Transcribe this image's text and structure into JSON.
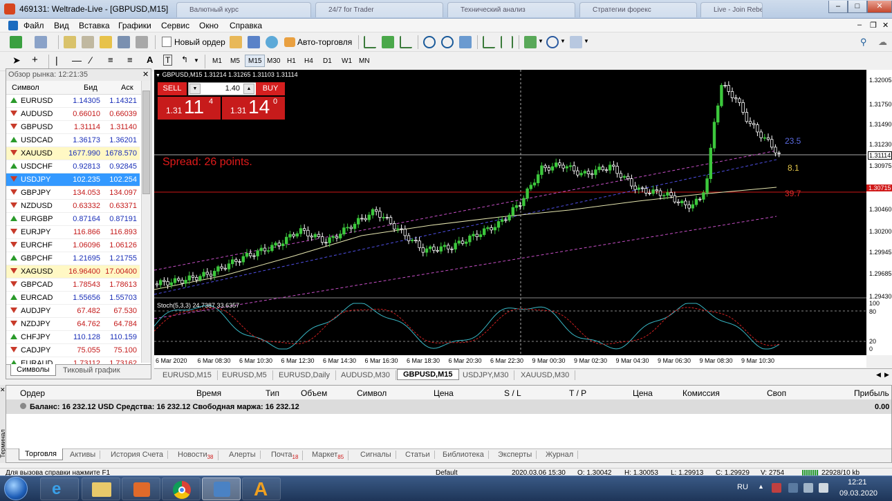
{
  "window": {
    "title": "469131: Weltrade-Live - [GBPUSD,M15]"
  },
  "browser_tabs": [
    "Валютный курс",
    "24/7 for Trader",
    "Технический анализ",
    "Стратегии форекс",
    "Live - Join Rebel",
    ""
  ],
  "menu": [
    "Файл",
    "Вид",
    "Вставка",
    "Графики",
    "Сервис",
    "Окно",
    "Справка"
  ],
  "toolbar": {
    "new_order": "Новый ордер",
    "autotrading": "Авто-торговля"
  },
  "timeframes": [
    "M1",
    "M5",
    "M15",
    "M30",
    "H1",
    "H4",
    "D1",
    "W1",
    "MN"
  ],
  "market_watch": {
    "header": "Обзор рынка: 12:21:35",
    "col_symbol": "Символ",
    "col_bid": "Бид",
    "col_ask": "Аск",
    "rows": [
      {
        "symbol": "EURUSD",
        "bid": "1.14305",
        "ask": "1.14321",
        "dir": "up",
        "color": "blue"
      },
      {
        "symbol": "AUDUSD",
        "bid": "0.66010",
        "ask": "0.66039",
        "dir": "down",
        "color": "red"
      },
      {
        "symbol": "GBPUSD",
        "bid": "1.31114",
        "ask": "1.31140",
        "dir": "down",
        "color": "red"
      },
      {
        "symbol": "USDCAD",
        "bid": "1.36173",
        "ask": "1.36201",
        "dir": "up",
        "color": "blue"
      },
      {
        "symbol": "XAUUSD",
        "bid": "1677.990",
        "ask": "1678.570",
        "dir": "down",
        "color": "blue",
        "hl": true
      },
      {
        "symbol": "USDCHF",
        "bid": "0.92813",
        "ask": "0.92845",
        "dir": "up",
        "color": "blue"
      },
      {
        "symbol": "USDJPY",
        "bid": "102.235",
        "ask": "102.254",
        "dir": "down",
        "color": "blue",
        "sel": true
      },
      {
        "symbol": "GBPJPY",
        "bid": "134.053",
        "ask": "134.097",
        "dir": "down",
        "color": "red"
      },
      {
        "symbol": "NZDUSD",
        "bid": "0.63332",
        "ask": "0.63371",
        "dir": "down",
        "color": "red"
      },
      {
        "symbol": "EURGBP",
        "bid": "0.87164",
        "ask": "0.87191",
        "dir": "up",
        "color": "blue"
      },
      {
        "symbol": "EURJPY",
        "bid": "116.866",
        "ask": "116.893",
        "dir": "down",
        "color": "red"
      },
      {
        "symbol": "EURCHF",
        "bid": "1.06096",
        "ask": "1.06126",
        "dir": "down",
        "color": "red"
      },
      {
        "symbol": "GBPCHF",
        "bid": "1.21695",
        "ask": "1.21755",
        "dir": "up",
        "color": "blue"
      },
      {
        "symbol": "XAGUSD",
        "bid": "16.96400",
        "ask": "17.00400",
        "dir": "down",
        "color": "red",
        "hl": true
      },
      {
        "symbol": "GBPCAD",
        "bid": "1.78543",
        "ask": "1.78613",
        "dir": "down",
        "color": "red"
      },
      {
        "symbol": "EURCAD",
        "bid": "1.55656",
        "ask": "1.55703",
        "dir": "up",
        "color": "blue"
      },
      {
        "symbol": "AUDJPY",
        "bid": "67.482",
        "ask": "67.530",
        "dir": "down",
        "color": "red"
      },
      {
        "symbol": "NZDJPY",
        "bid": "64.762",
        "ask": "64.784",
        "dir": "down",
        "color": "red"
      },
      {
        "symbol": "CHFJPY",
        "bid": "110.128",
        "ask": "110.159",
        "dir": "up",
        "color": "blue"
      },
      {
        "symbol": "CADJPY",
        "bid": "75.055",
        "ask": "75.100",
        "dir": "down",
        "color": "red"
      },
      {
        "symbol": "EURAUD",
        "bid": "1.73112",
        "ask": "1.73162",
        "dir": "up",
        "color": "red"
      }
    ],
    "tab_symbols": "Символы",
    "tab_tick": "Тиковый график"
  },
  "chart": {
    "header": "GBPUSD,M15  1.31214 1.31265 1.31103 1.31114",
    "sell_label": "SELL",
    "buy_label": "BUY",
    "lot": "1.40",
    "sell_price_small": "1.31",
    "sell_price_big": "11",
    "sell_price_sup": "4",
    "buy_price_small": "1.31",
    "buy_price_big": "14",
    "buy_price_sup": "0",
    "spread": "Spread: 26 points.",
    "fib_labels": [
      "23.5",
      "8.1",
      "39.7"
    ],
    "stoch_label": "Stoch(5,3,3) 24.7387 33.6357",
    "price_ticks": [
      "1.32005",
      "1.31750",
      "1.31490",
      "1.31230",
      "1.31114",
      "1.30975",
      "1.30715",
      "1.30460",
      "1.30200",
      "1.29945",
      "1.29685",
      "1.29430"
    ],
    "stoch_ticks": [
      "100",
      "80",
      "20",
      "0"
    ],
    "time_ticks": [
      "6 Mar 2020",
      "6 Mar 08:30",
      "6 Mar 10:30",
      "6 Mar 12:30",
      "6 Mar 14:30",
      "6 Mar 16:30",
      "6 Mar 18:30",
      "6 Mar 20:30",
      "6 Mar 22:30",
      "9 Mar 00:30",
      "9 Mar 02:30",
      "9 Mar 04:30",
      "9 Mar 06:30",
      "9 Mar 08:30",
      "9 Mar 10:30"
    ],
    "colors": {
      "bull": "#3cc83c",
      "bear": "#ffffff",
      "ma": "#e6e6b0",
      "channel": "#c850c8",
      "fib": "#5050e6",
      "hline": "#d01818"
    }
  },
  "chart_tabs": [
    "EURUSD,M15",
    "EURUSD,M5",
    "EURUSD,Daily",
    "AUDUSD,M30",
    "GBPUSD,M15",
    "USDJPY,M30",
    "XAUUSD,M30"
  ],
  "terminal": {
    "columns": [
      "Ордер",
      "Время",
      "Тип",
      "Объем",
      "Символ",
      "Цена",
      "S / L",
      "T / P",
      "Цена",
      "Комиссия",
      "Своп",
      "Прибыль"
    ],
    "balance": "Баланс: 16 232.12 USD  Средства: 16 232.12  Свободная маржа: 16 232.12",
    "profit": "0.00",
    "side_label": "Терминал",
    "tabs": [
      {
        "label": "Торговля",
        "badge": ""
      },
      {
        "label": "Активы",
        "badge": ""
      },
      {
        "label": "История Счета",
        "badge": ""
      },
      {
        "label": "Новости",
        "badge": "38"
      },
      {
        "label": "Алерты",
        "badge": ""
      },
      {
        "label": "Почта",
        "badge": "18"
      },
      {
        "label": "Маркет",
        "badge": "85"
      },
      {
        "label": "Сигналы",
        "badge": ""
      },
      {
        "label": "Статьи",
        "badge": ""
      },
      {
        "label": "Библиотека",
        "badge": ""
      },
      {
        "label": "Эксперты",
        "badge": ""
      },
      {
        "label": "Журнал",
        "badge": ""
      }
    ]
  },
  "status": {
    "help": "Для вызова справки нажмите F1",
    "profile": "Default",
    "datetime": "2020.03.06 15:30",
    "open": "O: 1.30042",
    "high": "H: 1.30053",
    "low": "L: 1.29913",
    "close": "C: 1.29929",
    "volume": "V: 2754",
    "traffic": "22928/10 kb"
  },
  "taskbar": {
    "lang": "RU",
    "time": "12:21",
    "date": "09.03.2020"
  }
}
